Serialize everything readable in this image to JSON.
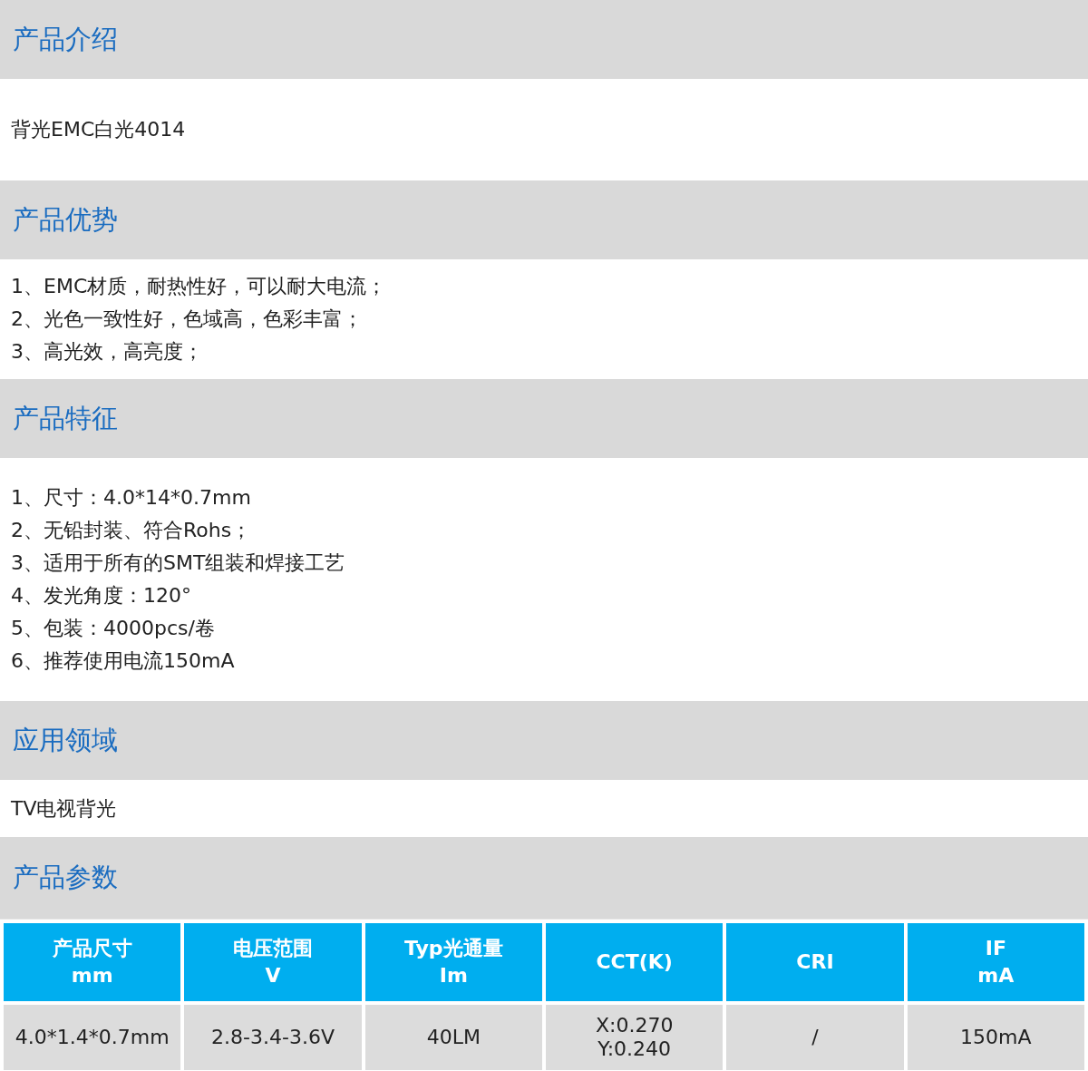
{
  "sections": [
    {
      "title": "产品介绍",
      "lines": [
        "背光EMC白光4014"
      ]
    },
    {
      "title": "产品优势",
      "lines": [
        "1、EMC材质，耐热性好，可以耐大电流；",
        "2、光色一致性好，色域高，色彩丰富；",
        "3、高光效，高亮度；"
      ]
    },
    {
      "title": "产品特征",
      "lines": [
        "1、尺寸：4.0*14*0.7mm",
        "2、无铅封装、符合Rohs；",
        "3、适用于所有的SMT组装和焊接工艺",
        "4、发光角度：120°",
        "5、包装：4000pcs/卷",
        "6、推荐使用电流150mA"
      ]
    },
    {
      "title": "应用领域",
      "lines": [
        "TV电视背光"
      ]
    }
  ],
  "parameters": {
    "title": "产品参数",
    "columns": [
      [
        "产品尺寸",
        "mm"
      ],
      [
        "电压范围",
        "V"
      ],
      [
        "Typ光通量",
        "Im"
      ],
      [
        "CCT(K)"
      ],
      [
        "CRI"
      ],
      [
        "IF",
        "mA"
      ]
    ],
    "row": [
      [
        "4.0*1.4*0.7mm"
      ],
      [
        "2.8-3.4-3.6V"
      ],
      [
        "40LM"
      ],
      [
        "X:0.270",
        "Y:0.240"
      ],
      [
        "/"
      ],
      [
        "150mA"
      ]
    ]
  }
}
